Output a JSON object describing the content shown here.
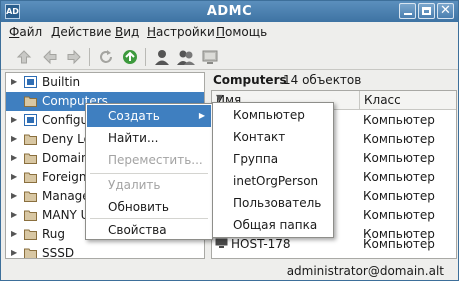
{
  "window": {
    "app_icon_text": "AD",
    "title": "ADMC",
    "controls": {
      "minimize": "minimize",
      "maximize": "maximize",
      "close": "✕"
    }
  },
  "menubar": {
    "items": [
      {
        "mnemonic": "Ф",
        "rest": "айл"
      },
      {
        "mnemonic": "Д",
        "rest": "ействие"
      },
      {
        "mnemonic": "В",
        "rest": "ид"
      },
      {
        "mnemonic": "Н",
        "rest": "астройки"
      },
      {
        "mnemonic": "П",
        "rest": "омощь"
      }
    ]
  },
  "toolbar": {
    "icons": [
      "up-arrow-icon",
      "back-arrow-icon",
      "forward-arrow-icon",
      "refresh-icon",
      "recycle-icon",
      "user-icon",
      "users-icon",
      "computer-icon"
    ]
  },
  "tree": {
    "items": [
      {
        "label": "Builtin",
        "icon": "special-folder",
        "expandable": true,
        "selected": false
      },
      {
        "label": "Computers",
        "icon": "folder",
        "expandable": false,
        "selected": true
      },
      {
        "label": "Configur",
        "icon": "special-folder",
        "expandable": true,
        "selected": false
      },
      {
        "label": "Deny Lo",
        "icon": "folder",
        "expandable": true,
        "selected": false
      },
      {
        "label": "Domain",
        "icon": "folder",
        "expandable": true,
        "selected": false
      },
      {
        "label": "ForeignS",
        "icon": "folder",
        "expandable": true,
        "selected": false
      },
      {
        "label": "Manage",
        "icon": "folder",
        "expandable": true,
        "selected": false
      },
      {
        "label": "MANY U",
        "icon": "folder",
        "expandable": true,
        "selected": false
      },
      {
        "label": "Rug",
        "icon": "folder",
        "expandable": true,
        "selected": false
      },
      {
        "label": "SSSD",
        "icon": "folder",
        "expandable": true,
        "selected": false
      }
    ]
  },
  "content": {
    "title": "Computers",
    "count": "14 объектов",
    "columns": {
      "name": "Имя",
      "class": "Класс"
    },
    "rows": [
      {
        "name": "",
        "class": "Компьютер"
      },
      {
        "name": "",
        "class": "Компьютер"
      },
      {
        "name": "",
        "class": "Компьютер"
      },
      {
        "name": "",
        "class": "Компьютер"
      },
      {
        "name": "",
        "class": "Компьютер"
      },
      {
        "name": "",
        "class": "Компьютер"
      },
      {
        "name": "",
        "class": "Компьютер"
      },
      {
        "name": "",
        "class": "Компьютер"
      },
      {
        "name": "HOST-178",
        "class": "Компьютер"
      }
    ]
  },
  "context_menu": {
    "items": [
      {
        "label": "Создать",
        "highlighted": true,
        "disabled": false,
        "submenu": true
      },
      {
        "label": "Найти...",
        "highlighted": false,
        "disabled": false,
        "submenu": false
      },
      {
        "label": "Переместить...",
        "highlighted": false,
        "disabled": true,
        "submenu": false
      },
      {
        "label": "Удалить",
        "highlighted": false,
        "disabled": true,
        "submenu": false
      },
      {
        "label": "Обновить",
        "highlighted": false,
        "disabled": false,
        "submenu": false
      },
      {
        "label": "Свойства",
        "highlighted": false,
        "disabled": false,
        "submenu": false
      }
    ]
  },
  "submenu": {
    "items": [
      "Компьютер",
      "Контакт",
      "Группа",
      "inetOrgPerson",
      "Пользователь",
      "Общая папка"
    ]
  },
  "status": {
    "text": "administrator@domain.alt"
  },
  "colors": {
    "titlebar": "#4a7fb0",
    "selection": "#3f7fc0",
    "folder": "#8a6f3e",
    "special_folder": "#2e6db4"
  }
}
